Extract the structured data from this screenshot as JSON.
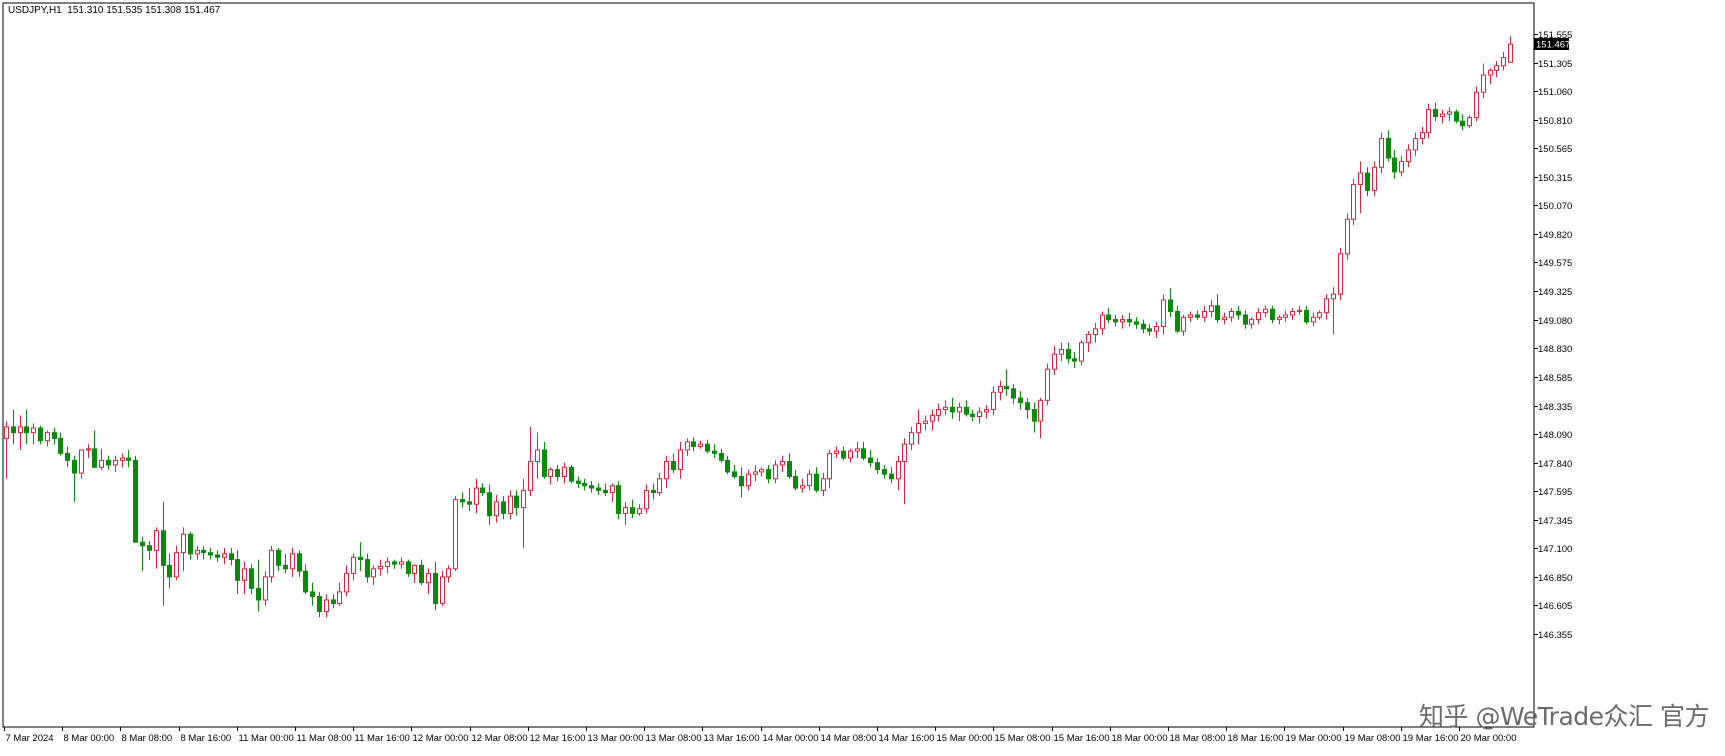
{
  "title": {
    "symbol": "USDJPY,H1",
    "ohlc": "151.310 151.535 151.308 151.467"
  },
  "chart_data": {
    "type": "candlestick",
    "symbol": "USDJPY",
    "timeframe": "H1",
    "y_ticks": [
      "151.555",
      "151.305",
      "151.060",
      "150.810",
      "150.565",
      "150.315",
      "150.070",
      "149.820",
      "149.575",
      "149.325",
      "149.080",
      "148.830",
      "148.585",
      "148.335",
      "148.090",
      "147.840",
      "147.595",
      "147.345",
      "147.100",
      "146.850",
      "146.605",
      "146.355"
    ],
    "current_price_label": "151.467",
    "x_ticks": [
      "7 Mar 2024",
      "8 Mar 00:00",
      "8 Mar 08:00",
      "8 Mar 16:00",
      "11 Mar 00:00",
      "11 Mar 08:00",
      "11 Mar 16:00",
      "12 Mar 00:00",
      "12 Mar 08:00",
      "12 Mar 16:00",
      "13 Mar 00:00",
      "13 Mar 08:00",
      "13 Mar 16:00",
      "14 Mar 00:00",
      "14 Mar 08:00",
      "14 Mar 16:00",
      "15 Mar 00:00",
      "15 Mar 08:00",
      "15 Mar 16:00",
      "18 Mar 00:00",
      "18 Mar 08:00",
      "18 Mar 16:00",
      "19 Mar 00:00",
      "19 Mar 08:00",
      "19 Mar 16:00",
      "20 Mar 00:00"
    ],
    "colors": {
      "bull": "#d62839",
      "bear": "#0a8a0a",
      "axis": "#000000",
      "grid": "none"
    },
    "candles": [
      [
        148.05,
        148.2,
        147.7,
        148.15
      ],
      [
        148.15,
        148.3,
        148.0,
        148.1
      ],
      [
        148.1,
        148.25,
        147.95,
        148.15
      ],
      [
        148.15,
        148.3,
        148.0,
        148.1
      ],
      [
        148.1,
        148.18,
        148.0,
        148.14
      ],
      [
        148.14,
        148.16,
        148.0,
        148.03
      ],
      [
        148.03,
        148.12,
        147.98,
        148.1
      ],
      [
        148.1,
        148.14,
        148.0,
        148.05
      ],
      [
        148.05,
        148.1,
        147.9,
        147.92
      ],
      [
        147.92,
        147.98,
        147.8,
        147.86
      ],
      [
        147.86,
        147.9,
        147.5,
        147.75
      ],
      [
        147.75,
        147.95,
        147.7,
        147.95
      ],
      [
        147.95,
        148.0,
        147.88,
        147.96
      ],
      [
        147.96,
        148.12,
        147.9,
        147.8
      ],
      [
        147.8,
        147.96,
        147.78,
        147.86
      ],
      [
        147.86,
        147.9,
        147.78,
        147.82
      ],
      [
        147.82,
        147.9,
        147.76,
        147.86
      ],
      [
        147.86,
        147.92,
        147.8,
        147.88
      ],
      [
        147.88,
        147.95,
        147.8,
        147.86
      ],
      [
        147.86,
        147.9,
        147.2,
        147.15
      ],
      [
        147.15,
        147.2,
        146.9,
        147.12
      ],
      [
        147.12,
        147.16,
        147.0,
        147.08
      ],
      [
        147.08,
        147.28,
        146.92,
        147.25
      ],
      [
        147.25,
        147.5,
        146.6,
        146.95
      ],
      [
        146.95,
        147.05,
        146.75,
        146.85
      ],
      [
        146.85,
        147.12,
        146.82,
        147.06
      ],
      [
        147.06,
        147.28,
        146.9,
        147.22
      ],
      [
        147.22,
        147.24,
        147.0,
        147.05
      ],
      [
        147.05,
        147.12,
        147.0,
        147.08
      ],
      [
        147.08,
        147.12,
        147.0,
        147.06
      ],
      [
        147.06,
        147.1,
        147.0,
        147.04
      ],
      [
        147.04,
        147.08,
        146.98,
        147.02
      ],
      [
        147.02,
        147.1,
        146.96,
        147.05
      ],
      [
        147.05,
        147.1,
        146.95,
        147.0
      ],
      [
        147.0,
        147.08,
        146.7,
        146.82
      ],
      [
        146.82,
        146.98,
        146.7,
        146.92
      ],
      [
        146.92,
        146.96,
        146.7,
        146.75
      ],
      [
        146.75,
        147.0,
        146.55,
        146.65
      ],
      [
        146.65,
        146.9,
        146.6,
        146.85
      ],
      [
        146.85,
        147.12,
        146.8,
        147.08
      ],
      [
        147.08,
        147.1,
        146.9,
        146.95
      ],
      [
        146.95,
        147.05,
        146.88,
        146.92
      ],
      [
        146.92,
        147.1,
        146.85,
        147.05
      ],
      [
        147.05,
        147.08,
        146.85,
        146.9
      ],
      [
        146.9,
        146.96,
        146.7,
        146.72
      ],
      [
        146.72,
        146.8,
        146.6,
        146.68
      ],
      [
        146.68,
        146.72,
        146.5,
        146.55
      ],
      [
        146.55,
        146.7,
        146.5,
        146.65
      ],
      [
        146.65,
        146.7,
        146.58,
        146.62
      ],
      [
        146.62,
        146.8,
        146.6,
        146.72
      ],
      [
        146.72,
        146.95,
        146.68,
        146.88
      ],
      [
        146.88,
        147.05,
        146.82,
        147.02
      ],
      [
        147.02,
        147.15,
        146.9,
        147.0
      ],
      [
        147.0,
        147.05,
        146.8,
        146.85
      ],
      [
        146.85,
        146.95,
        146.78,
        146.92
      ],
      [
        146.92,
        147.0,
        146.86,
        146.94
      ],
      [
        146.94,
        147.02,
        146.88,
        146.98
      ],
      [
        146.98,
        147.0,
        146.92,
        146.96
      ],
      [
        146.96,
        147.02,
        146.92,
        146.98
      ],
      [
        146.98,
        147.0,
        146.85,
        146.88
      ],
      [
        146.88,
        146.96,
        146.8,
        146.95
      ],
      [
        146.95,
        147.0,
        146.78,
        146.8
      ],
      [
        146.8,
        146.92,
        146.7,
        146.88
      ],
      [
        146.88,
        146.98,
        146.56,
        146.62
      ],
      [
        146.62,
        146.9,
        146.6,
        146.85
      ],
      [
        146.85,
        146.95,
        146.8,
        146.92
      ],
      [
        146.92,
        147.55,
        146.9,
        147.52
      ],
      [
        147.52,
        147.58,
        147.45,
        147.5
      ],
      [
        147.5,
        147.62,
        147.42,
        147.48
      ],
      [
        147.48,
        147.7,
        147.4,
        147.62
      ],
      [
        147.62,
        147.66,
        147.55,
        147.58
      ],
      [
        147.58,
        147.65,
        147.3,
        147.38
      ],
      [
        147.38,
        147.56,
        147.32,
        147.5
      ],
      [
        147.5,
        147.55,
        147.35,
        147.4
      ],
      [
        147.4,
        147.6,
        147.35,
        147.55
      ],
      [
        147.55,
        147.6,
        147.38,
        147.45
      ],
      [
        147.45,
        147.7,
        147.1,
        147.6
      ],
      [
        147.6,
        148.15,
        147.55,
        147.85
      ],
      [
        147.85,
        148.1,
        147.7,
        147.95
      ],
      [
        147.95,
        148.02,
        147.7,
        147.72
      ],
      [
        147.72,
        147.8,
        147.65,
        147.78
      ],
      [
        147.78,
        147.82,
        147.68,
        147.72
      ],
      [
        147.72,
        147.84,
        147.66,
        147.8
      ],
      [
        147.8,
        147.82,
        147.66,
        147.68
      ],
      [
        147.68,
        147.72,
        147.62,
        147.66
      ],
      [
        147.66,
        147.7,
        147.6,
        147.64
      ],
      [
        147.64,
        147.68,
        147.58,
        147.62
      ],
      [
        147.62,
        147.66,
        147.56,
        147.6
      ],
      [
        147.6,
        147.66,
        147.55,
        147.58
      ],
      [
        147.58,
        147.66,
        147.5,
        147.64
      ],
      [
        147.64,
        147.68,
        147.35,
        147.4
      ],
      [
        147.4,
        147.5,
        147.3,
        147.45
      ],
      [
        147.45,
        147.52,
        147.36,
        147.4
      ],
      [
        147.4,
        147.48,
        147.38,
        147.44
      ],
      [
        147.44,
        147.65,
        147.4,
        147.6
      ],
      [
        147.6,
        147.66,
        147.52,
        147.58
      ],
      [
        147.58,
        147.75,
        147.55,
        147.7
      ],
      [
        147.7,
        147.9,
        147.62,
        147.85
      ],
      [
        147.85,
        147.92,
        147.75,
        147.78
      ],
      [
        147.78,
        148.02,
        147.7,
        147.95
      ],
      [
        147.95,
        148.05,
        147.9,
        148.02
      ],
      [
        148.02,
        148.06,
        147.94,
        147.98
      ],
      [
        147.98,
        148.03,
        147.96,
        148.0
      ],
      [
        148.0,
        148.04,
        147.92,
        147.94
      ],
      [
        147.94,
        148.0,
        147.88,
        147.92
      ],
      [
        147.92,
        147.96,
        147.84,
        147.86
      ],
      [
        147.86,
        147.9,
        147.74,
        147.76
      ],
      [
        147.76,
        147.82,
        147.7,
        147.72
      ],
      [
        147.72,
        147.8,
        147.54,
        147.64
      ],
      [
        147.64,
        147.78,
        147.6,
        147.74
      ],
      [
        147.74,
        147.82,
        147.68,
        147.76
      ],
      [
        147.76,
        147.8,
        147.72,
        147.78
      ],
      [
        147.78,
        147.82,
        147.66,
        147.7
      ],
      [
        147.7,
        147.86,
        147.66,
        147.82
      ],
      [
        147.82,
        147.9,
        147.76,
        147.85
      ],
      [
        147.85,
        147.92,
        147.7,
        147.72
      ],
      [
        147.72,
        147.78,
        147.6,
        147.62
      ],
      [
        147.62,
        147.7,
        147.58,
        147.64
      ],
      [
        147.64,
        147.78,
        147.6,
        147.74
      ],
      [
        147.74,
        147.8,
        147.58,
        147.6
      ],
      [
        147.6,
        147.75,
        147.55,
        147.7
      ],
      [
        147.7,
        147.95,
        147.62,
        147.92
      ],
      [
        147.92,
        147.98,
        147.88,
        147.94
      ],
      [
        147.94,
        147.98,
        147.86,
        147.88
      ],
      [
        147.88,
        147.96,
        147.84,
        147.94
      ],
      [
        147.94,
        148.02,
        147.88,
        147.96
      ],
      [
        147.96,
        148.02,
        147.86,
        147.88
      ],
      [
        147.88,
        147.95,
        147.8,
        147.84
      ],
      [
        147.84,
        147.88,
        147.74,
        147.78
      ],
      [
        147.78,
        147.82,
        147.7,
        147.74
      ],
      [
        147.74,
        147.8,
        147.66,
        147.7
      ],
      [
        147.7,
        147.9,
        147.6,
        147.85
      ],
      [
        147.85,
        148.05,
        147.48,
        148.0
      ],
      [
        148.0,
        148.15,
        147.95,
        148.1
      ],
      [
        148.1,
        148.3,
        148.0,
        148.18
      ],
      [
        148.18,
        148.25,
        148.12,
        148.2
      ],
      [
        148.2,
        148.3,
        148.12,
        148.25
      ],
      [
        148.25,
        148.35,
        148.2,
        148.3
      ],
      [
        148.3,
        148.38,
        148.25,
        148.32
      ],
      [
        148.32,
        148.4,
        148.22,
        148.28
      ],
      [
        148.28,
        148.36,
        148.2,
        148.32
      ],
      [
        148.32,
        148.38,
        148.24,
        148.26
      ],
      [
        148.26,
        148.3,
        148.2,
        148.24
      ],
      [
        148.24,
        148.32,
        148.18,
        148.28
      ],
      [
        148.28,
        148.34,
        148.22,
        148.3
      ],
      [
        148.3,
        148.5,
        148.25,
        148.45
      ],
      [
        148.45,
        148.55,
        148.38,
        148.5
      ],
      [
        148.5,
        148.65,
        148.42,
        148.48
      ],
      [
        148.48,
        148.52,
        148.35,
        148.4
      ],
      [
        148.4,
        148.46,
        148.3,
        148.36
      ],
      [
        148.36,
        148.4,
        148.22,
        148.3
      ],
      [
        148.3,
        148.36,
        148.1,
        148.2
      ],
      [
        148.2,
        148.4,
        148.05,
        148.38
      ],
      [
        148.38,
        148.7,
        148.34,
        148.65
      ],
      [
        148.65,
        148.85,
        148.6,
        148.78
      ],
      [
        148.78,
        148.88,
        148.72,
        148.82
      ],
      [
        148.82,
        148.88,
        148.7,
        148.74
      ],
      [
        148.74,
        148.8,
        148.66,
        148.72
      ],
      [
        148.72,
        148.9,
        148.68,
        148.88
      ],
      [
        148.88,
        148.98,
        148.8,
        148.95
      ],
      [
        148.95,
        149.05,
        148.88,
        149.0
      ],
      [
        149.0,
        149.15,
        148.95,
        149.12
      ],
      [
        149.12,
        149.18,
        149.05,
        149.08
      ],
      [
        149.08,
        149.12,
        149.02,
        149.06
      ],
      [
        149.06,
        149.12,
        149.0,
        149.08
      ],
      [
        149.08,
        149.14,
        149.02,
        149.06
      ],
      [
        149.06,
        149.1,
        149.0,
        149.04
      ],
      [
        149.04,
        149.08,
        148.96,
        149.0
      ],
      [
        149.0,
        149.04,
        148.94,
        148.98
      ],
      [
        148.98,
        149.06,
        148.92,
        149.02
      ],
      [
        149.02,
        149.3,
        148.95,
        149.25
      ],
      [
        149.25,
        149.35,
        149.1,
        149.15
      ],
      [
        149.15,
        149.2,
        148.96,
        148.98
      ],
      [
        148.98,
        149.12,
        148.94,
        149.1
      ],
      [
        149.1,
        149.15,
        149.06,
        149.12
      ],
      [
        149.12,
        149.16,
        149.08,
        149.1
      ],
      [
        149.1,
        149.2,
        149.06,
        149.15
      ],
      [
        149.15,
        149.25,
        149.1,
        149.2
      ],
      [
        149.2,
        149.3,
        149.05,
        149.08
      ],
      [
        149.08,
        149.14,
        149.04,
        149.1
      ],
      [
        149.1,
        149.18,
        149.06,
        149.15
      ],
      [
        149.15,
        149.2,
        149.08,
        149.12
      ],
      [
        149.12,
        149.16,
        149.0,
        149.04
      ],
      [
        149.04,
        149.1,
        149.0,
        149.08
      ],
      [
        149.08,
        149.18,
        149.04,
        149.14
      ],
      [
        149.14,
        149.2,
        149.1,
        149.17
      ],
      [
        149.17,
        149.2,
        149.05,
        149.08
      ],
      [
        149.08,
        149.12,
        149.04,
        149.1
      ],
      [
        149.1,
        149.16,
        149.06,
        149.12
      ],
      [
        149.12,
        149.18,
        149.08,
        149.15
      ],
      [
        149.15,
        149.2,
        149.12,
        149.16
      ],
      [
        149.16,
        149.2,
        149.04,
        149.06
      ],
      [
        149.06,
        149.14,
        149.02,
        149.1
      ],
      [
        149.1,
        149.16,
        149.08,
        149.14
      ],
      [
        149.14,
        149.3,
        149.08,
        149.26
      ],
      [
        149.26,
        149.36,
        148.95,
        149.3
      ],
      [
        149.3,
        149.7,
        149.25,
        149.65
      ],
      [
        149.65,
        150.0,
        149.6,
        149.95
      ],
      [
        149.95,
        150.3,
        149.9,
        150.25
      ],
      [
        150.25,
        150.45,
        150.0,
        150.35
      ],
      [
        150.35,
        150.4,
        150.15,
        150.2
      ],
      [
        150.2,
        150.45,
        150.15,
        150.4
      ],
      [
        150.4,
        150.7,
        150.35,
        150.65
      ],
      [
        150.65,
        150.72,
        150.45,
        150.48
      ],
      [
        150.48,
        150.55,
        150.3,
        150.36
      ],
      [
        150.36,
        150.5,
        150.32,
        150.45
      ],
      [
        150.45,
        150.6,
        150.4,
        150.55
      ],
      [
        150.55,
        150.7,
        150.5,
        150.65
      ],
      [
        150.65,
        150.75,
        150.6,
        150.7
      ],
      [
        150.7,
        150.95,
        150.65,
        150.9
      ],
      [
        150.9,
        150.96,
        150.8,
        150.84
      ],
      [
        150.84,
        150.9,
        150.78,
        150.86
      ],
      [
        150.86,
        150.92,
        150.8,
        150.88
      ],
      [
        150.88,
        150.9,
        150.78,
        150.8
      ],
      [
        150.8,
        150.86,
        150.72,
        150.76
      ],
      [
        150.76,
        150.85,
        150.74,
        150.83
      ],
      [
        150.83,
        151.1,
        150.8,
        151.05
      ],
      [
        151.05,
        151.3,
        151.0,
        151.2
      ],
      [
        151.2,
        151.26,
        151.12,
        151.24
      ],
      [
        151.24,
        151.32,
        151.18,
        151.28
      ],
      [
        151.28,
        151.4,
        151.24,
        151.35
      ],
      [
        151.31,
        151.535,
        151.308,
        151.467
      ]
    ]
  },
  "watermark": "知乎 @WeTrade众汇 官方"
}
